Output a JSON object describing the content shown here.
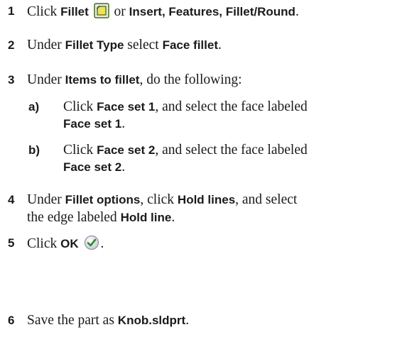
{
  "steps": {
    "s1": {
      "num": "1",
      "t1": "Click ",
      "b1": "Fillet",
      "t2": " or ",
      "b2": "Insert, Features, Fillet/Round",
      "t3": "."
    },
    "s2": {
      "num": "2",
      "t1": "Under ",
      "b1": "Fillet Type",
      "t2": " select ",
      "b2": "Face fillet",
      "t3": "."
    },
    "s3": {
      "num": "3",
      "t1": "Under ",
      "b1": "Items to fillet",
      "t2": ", do the following:"
    },
    "s3a": {
      "letter": "a)",
      "t1": "Click ",
      "b1": "Face set 1",
      "t2": ", and select the face labeled",
      "b2": "Face set 1",
      "t3": "."
    },
    "s3b": {
      "letter": "b)",
      "t1": "Click ",
      "b1": "Face set 2",
      "t2": ", and select the face labeled",
      "b2": "Face set 2",
      "t3": "."
    },
    "s4": {
      "num": "4",
      "t1": "Under ",
      "b1": "Fillet options",
      "t2": ", click ",
      "b2": "Hold lines",
      "t3": ", and select",
      "t4": "the edge labeled ",
      "b3": "Hold line",
      "t5": "."
    },
    "s5": {
      "num": "5",
      "t1": "Click ",
      "b1": "OK",
      "t2": "."
    },
    "s6": {
      "num": "6",
      "t1": "Save the part as ",
      "b1": "Knob.sldprt",
      "t2": "."
    }
  },
  "icons": {
    "fillet": "fillet-toolbar-icon",
    "ok": "ok-checkmark-icon"
  },
  "colors": {
    "text": "#1a1a1a",
    "icon_border": "#4a6a28",
    "icon_fill": "#f3df5a",
    "ok_check": "#2e8b2e"
  }
}
